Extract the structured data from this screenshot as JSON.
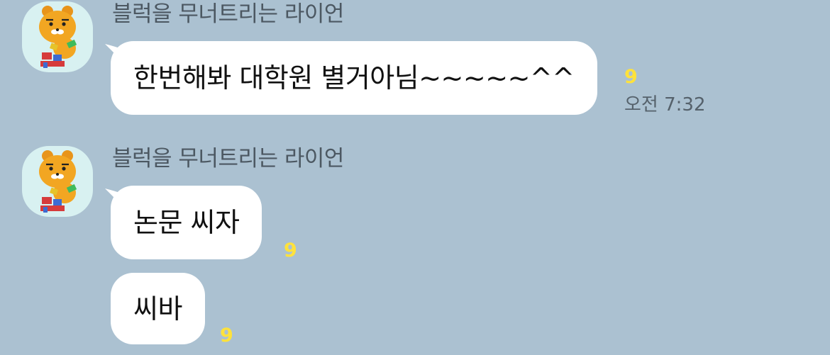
{
  "colors": {
    "background": "#abc1d1",
    "bubble": "#ffffff",
    "unread": "#ffe23b",
    "avatar_bg": "#d8f1f1"
  },
  "messages": [
    {
      "sender": "블럭을 무너트리는 라이언",
      "avatar_icon": "ryan-lion-icon",
      "bubbles": [
        {
          "text": "한번해봐 대학원 별거아님~~~~~^^",
          "unread": "9",
          "time": "오전 7:32"
        }
      ]
    },
    {
      "sender": "블럭을 무너트리는 라이언",
      "avatar_icon": "ryan-lion-icon",
      "bubbles": [
        {
          "text": "논문 씨자",
          "unread": "9"
        },
        {
          "text": "씨바",
          "unread": "9"
        }
      ]
    }
  ]
}
